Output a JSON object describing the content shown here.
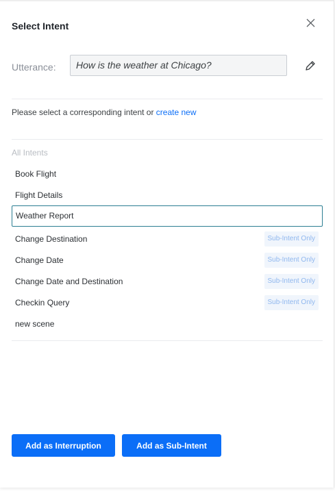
{
  "dialog": {
    "title": "Select Intent"
  },
  "utterance": {
    "label": "Utterance:",
    "value": "How is the weather at Chicago?"
  },
  "prompt": {
    "text": "Please select a corresponding intent or ",
    "link": "create new"
  },
  "intents": {
    "header": "All Intents",
    "items": [
      {
        "label": "Book Flight",
        "badge": null,
        "selected": false
      },
      {
        "label": "Flight Details",
        "badge": null,
        "selected": false
      },
      {
        "label": "Weather Report",
        "badge": null,
        "selected": true
      },
      {
        "label": "Change Destination",
        "badge": "Sub-Intent Only",
        "selected": false
      },
      {
        "label": "Change Date",
        "badge": "Sub-Intent Only",
        "selected": false
      },
      {
        "label": "Change Date and Destination",
        "badge": "Sub-Intent Only",
        "selected": false
      },
      {
        "label": "Checkin Query",
        "badge": "Sub-Intent Only",
        "selected": false
      },
      {
        "label": "new scene",
        "badge": null,
        "selected": false
      }
    ]
  },
  "actions": {
    "interruption_label": "Add as Interruption",
    "subintent_label": "Add as Sub-Intent"
  },
  "colors": {
    "accent": "#0b6ef7",
    "selected_border": "#2a7d91",
    "badge_bg": "#f0f5fc",
    "badge_text": "#8fb7ee"
  },
  "icons": {
    "close": "close-icon",
    "edit": "pencil-icon"
  }
}
